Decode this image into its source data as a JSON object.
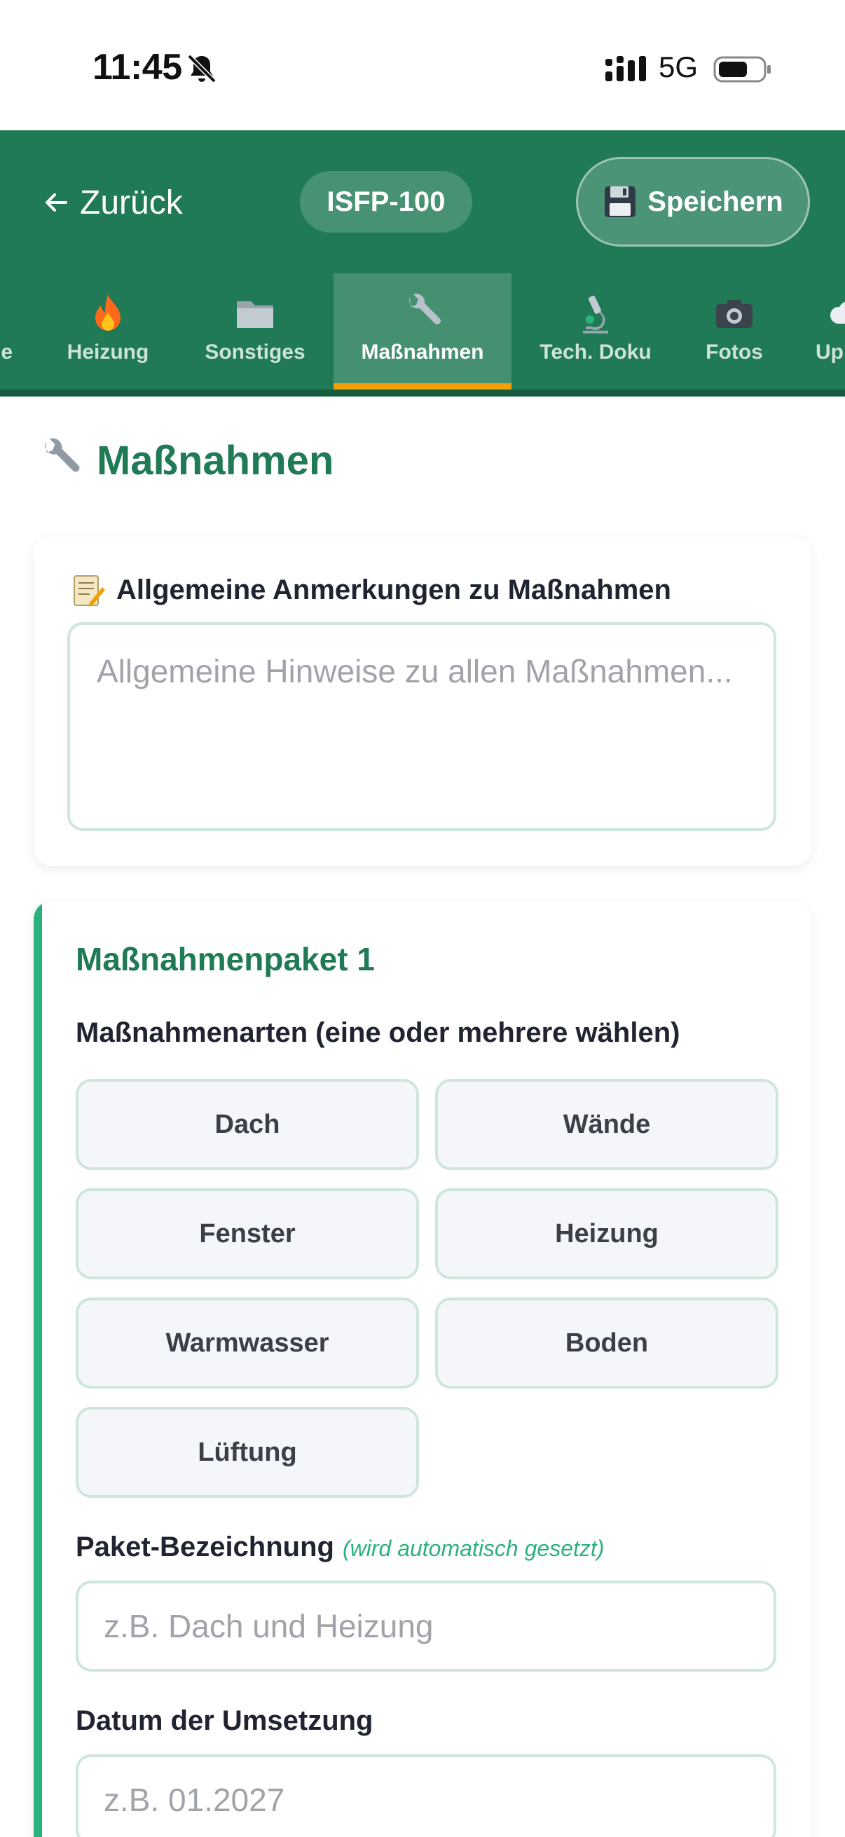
{
  "status_bar": {
    "time": "11:45",
    "network": "5G"
  },
  "header": {
    "back_label": "Zurück",
    "id_label": "ISFP-100",
    "save_label": "Speichern"
  },
  "tabs": [
    {
      "label": "e",
      "icon": "partial-icon"
    },
    {
      "label": "Heizung",
      "icon": "fire-icon"
    },
    {
      "label": "Sonstiges",
      "icon": "folder-icon"
    },
    {
      "label": "Maßnahmen",
      "icon": "wrench-icon",
      "active": true
    },
    {
      "label": "Tech. Doku",
      "icon": "microscope-icon"
    },
    {
      "label": "Fotos",
      "icon": "camera-icon"
    },
    {
      "label": "Up",
      "icon": "cloud-icon"
    }
  ],
  "page": {
    "title": "Maßnahmen"
  },
  "notes_card": {
    "label": "Allgemeine Anmerkungen zu Maßnahmen",
    "placeholder": "Allgemeine Hinweise zu allen Maßnahmen..."
  },
  "package": {
    "title": "Maßnahmenpaket 1",
    "types_label": "Maßnahmenarten (eine oder mehrere wählen)",
    "types": [
      "Dach",
      "Wände",
      "Fenster",
      "Heizung",
      "Warmwasser",
      "Boden",
      "Lüftung"
    ],
    "name_label": "Paket-Bezeichnung",
    "name_hint": "(wird automatisch gesetzt)",
    "name_placeholder": "z.B. Dach und Heizung",
    "date_label": "Datum der Umsetzung",
    "date_placeholder": "z.B. 01.2027"
  },
  "colors": {
    "primary": "#1f7a55",
    "accent_tab": "#f2a007",
    "chip_border": "#cfe6dc",
    "card_stripe": "#2bb27c"
  }
}
